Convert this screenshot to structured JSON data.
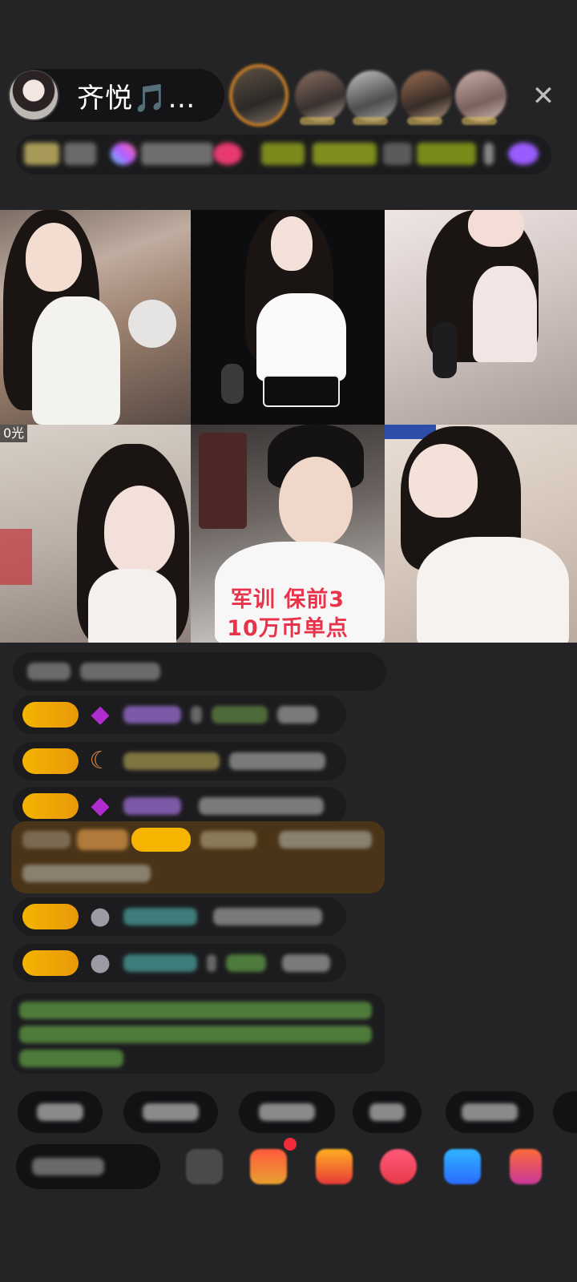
{
  "header": {
    "host_name": "齐悦🎵爱...",
    "close_icon": "close-icon"
  },
  "video_grid": {
    "cell4_tag": "0光",
    "cell5_overlay_line1": "军训 保前3",
    "cell5_overlay_line2": "10万币单点"
  },
  "colors": {
    "background": "#242426",
    "level_badge": "#f4b400",
    "overlay_text": "#e8334a",
    "announcement_bg": "#4a3418",
    "notification_dot": "#f02b3b"
  },
  "icons": {
    "host_avatar": "avatar",
    "gem": "purple-gem-icon",
    "moon": "moon-icon",
    "tools": [
      "emoji-icon",
      "gift-box-icon",
      "gift-icon",
      "heart-icon",
      "share-icon",
      "more-icon"
    ]
  }
}
